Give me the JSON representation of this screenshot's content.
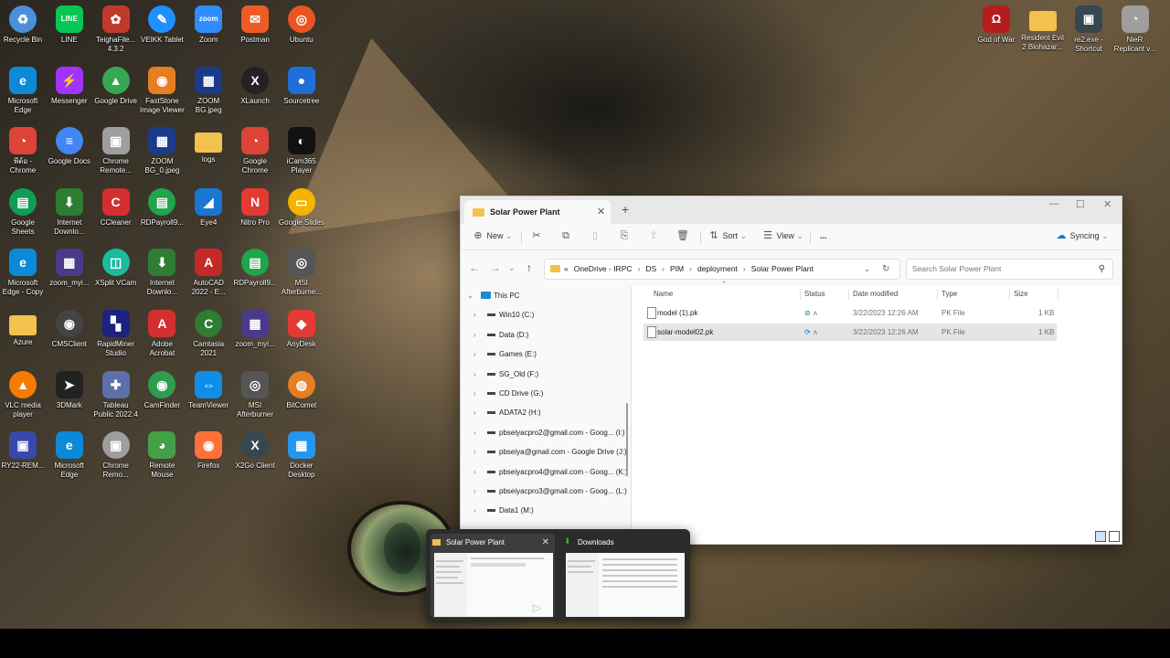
{
  "desktop": {
    "icons_left": [
      {
        "label": "Recycle Bin",
        "icon": "recycle-bin-icon",
        "color": "#4a90d9",
        "glyph": "♻"
      },
      {
        "label": "LINE",
        "icon": "line-icon",
        "color": "#06c755",
        "glyph": "LINE"
      },
      {
        "label": "TeighaFile... 4.3.2",
        "icon": "teigha-icon",
        "color": "#c0392b",
        "glyph": "✿"
      },
      {
        "label": "VEIKK Tablet",
        "icon": "veikk-icon",
        "color": "#1e90ff",
        "glyph": "✎"
      },
      {
        "label": "Zoom",
        "icon": "zoom-icon",
        "color": "#2d8cff",
        "glyph": "zoom"
      },
      {
        "label": "Postman",
        "icon": "postman-icon",
        "color": "#ef5b25",
        "glyph": "✉"
      },
      {
        "label": "Ubuntu",
        "icon": "ubuntu-icon",
        "color": "#e95420",
        "glyph": "◎"
      },
      {
        "label": "Microsoft Edge",
        "icon": "edge-icon",
        "color": "#0c8ad7",
        "glyph": "e"
      },
      {
        "label": "Messenger",
        "icon": "messenger-icon",
        "color": "#a033ff",
        "glyph": "⚡"
      },
      {
        "label": "Google Drive",
        "icon": "google-drive-icon",
        "color": "#34a853",
        "glyph": "▲"
      },
      {
        "label": "FastStone Image Viewer",
        "icon": "faststone-icon",
        "color": "#e67e22",
        "glyph": "◉"
      },
      {
        "label": "ZOOM BG.jpeg",
        "icon": "image-file-icon",
        "color": "#1b3a8a",
        "glyph": "▦"
      },
      {
        "label": "XLaunch",
        "icon": "xlaunch-icon",
        "color": "#222222",
        "glyph": "X"
      },
      {
        "label": "Sourcetree",
        "icon": "sourcetree-icon",
        "color": "#1f6fd6",
        "glyph": "●"
      },
      {
        "label": "พี่ต้อ - Chrome",
        "icon": "chrome-icon",
        "color": "#db4437",
        "glyph": "◔"
      },
      {
        "label": "Google Docs",
        "icon": "google-docs-icon",
        "color": "#4285f4",
        "glyph": "≡"
      },
      {
        "label": "Chrome Remote...",
        "icon": "chrome-remote-icon",
        "color": "#9e9e9e",
        "glyph": "▣"
      },
      {
        "label": "ZOOM BG_0.jpeg",
        "icon": "image-file-icon",
        "color": "#1b3a8a",
        "glyph": "▦"
      },
      {
        "label": "logs",
        "icon": "folder-icon",
        "color": "#f2c14e",
        "glyph": ""
      },
      {
        "label": "Google Chrome",
        "icon": "chrome-icon",
        "color": "#db4437",
        "glyph": "◔"
      },
      {
        "label": "iCam365 Player",
        "icon": "icam-icon",
        "color": "#111111",
        "glyph": "◐"
      },
      {
        "label": "Google Sheets",
        "icon": "google-sheets-icon",
        "color": "#0f9d58",
        "glyph": "▤"
      },
      {
        "label": "Internet Downlo...",
        "icon": "idm-icon",
        "color": "#2e7d32",
        "glyph": "⬇"
      },
      {
        "label": "CCleaner",
        "icon": "ccleaner-icon",
        "color": "#d32f2f",
        "glyph": "C"
      },
      {
        "label": "RDPayroll9...",
        "icon": "rdpayroll-icon",
        "color": "#1fa54a",
        "glyph": "▤"
      },
      {
        "label": "Eye4",
        "icon": "eye4-icon",
        "color": "#1976d2",
        "glyph": "◢"
      },
      {
        "label": "Nitro Pro",
        "icon": "nitro-icon",
        "color": "#e53935",
        "glyph": "N"
      },
      {
        "label": "Google Slides",
        "icon": "google-slides-icon",
        "color": "#f4b400",
        "glyph": "▭"
      },
      {
        "label": "Microsoft Edge - Copy",
        "icon": "edge-icon",
        "color": "#0c8ad7",
        "glyph": "e"
      },
      {
        "label": "zoom_myi...",
        "icon": "image-file-icon",
        "color": "#4a3a8a",
        "glyph": "▦"
      },
      {
        "label": "XSplit VCam",
        "icon": "xsplit-icon",
        "color": "#1abc9c",
        "glyph": "◫"
      },
      {
        "label": "Internet Downlo...",
        "icon": "idm-icon",
        "color": "#2e7d32",
        "glyph": "⬇"
      },
      {
        "label": "AutoCAD 2022 - E...",
        "icon": "autocad-icon",
        "color": "#c62828",
        "glyph": "A"
      },
      {
        "label": "RDPayroll9...",
        "icon": "rdpayroll-icon",
        "color": "#1fa54a",
        "glyph": "▤"
      },
      {
        "label": "MSI Afterburne...",
        "icon": "msi-icon",
        "color": "#555555",
        "glyph": "◎"
      },
      {
        "label": "Azure",
        "icon": "folder-icon",
        "color": "#f2c14e",
        "glyph": ""
      },
      {
        "label": "CMSClient",
        "icon": "cms-icon",
        "color": "#444444",
        "glyph": "◉"
      },
      {
        "label": "RapidMiner Studio",
        "icon": "rapidminer-icon",
        "color": "#1a237e",
        "glyph": "▚"
      },
      {
        "label": "Adobe Acrobat",
        "icon": "acrobat-icon",
        "color": "#d32f2f",
        "glyph": "A"
      },
      {
        "label": "Camtasia 2021",
        "icon": "camtasia-icon",
        "color": "#2e7d32",
        "glyph": "C"
      },
      {
        "label": "zoom_myi...",
        "icon": "image-file-icon",
        "color": "#4a3a8a",
        "glyph": "▦"
      },
      {
        "label": "AnyDesk",
        "icon": "anydesk-icon",
        "color": "#e53935",
        "glyph": "◆"
      },
      {
        "label": "VLC media player",
        "icon": "vlc-icon",
        "color": "#f57c00",
        "glyph": "▲"
      },
      {
        "label": "3DMark",
        "icon": "3dmark-icon",
        "color": "#222222",
        "glyph": "➤"
      },
      {
        "label": "Tableau Public 2022.4",
        "icon": "tableau-icon",
        "color": "#5b6fa8",
        "glyph": "✚"
      },
      {
        "label": "CamFinder",
        "icon": "camfinder-icon",
        "color": "#2e9d4f",
        "glyph": "◉"
      },
      {
        "label": "TeamViewer",
        "icon": "teamviewer-icon",
        "color": "#0e8ee9",
        "glyph": "⇔"
      },
      {
        "label": "MSI Afterburner",
        "icon": "msi-icon",
        "color": "#555555",
        "glyph": "◎"
      },
      {
        "label": "BitComet",
        "icon": "bitcomet-icon",
        "color": "#e67e22",
        "glyph": "◍"
      },
      {
        "label": "RY22-REM...",
        "icon": "remote-desktop-icon",
        "color": "#3949ab",
        "glyph": "▣"
      },
      {
        "label": "Microsoft Edge",
        "icon": "edge-icon",
        "color": "#0c8ad7",
        "glyph": "e"
      },
      {
        "label": "Chrome Remo...",
        "icon": "chrome-remote-icon",
        "color": "#9e9e9e",
        "glyph": "▣"
      },
      {
        "label": "Remote Mouse",
        "icon": "remote-mouse-icon",
        "color": "#43a047",
        "glyph": "◕"
      },
      {
        "label": "Firefox",
        "icon": "firefox-icon",
        "color": "#ff7139",
        "glyph": "◉"
      },
      {
        "label": "X2Go Client",
        "icon": "x2go-icon",
        "color": "#37474f",
        "glyph": "X"
      },
      {
        "label": "Docker Desktop",
        "icon": "docker-icon",
        "color": "#2496ed",
        "glyph": "▦"
      }
    ],
    "icons_right": [
      {
        "label": "God of War",
        "icon": "god-of-war-icon",
        "color": "#b71c1c",
        "glyph": "Ω"
      },
      {
        "label": "Resident Evil 2 Biohazar...",
        "icon": "folder-icon",
        "color": "#f2c14e",
        "glyph": ""
      },
      {
        "label": "re2.exe - Shortcut",
        "icon": "re2-icon",
        "color": "#37474f",
        "glyph": "▣"
      },
      {
        "label": "NieR Replicant v...",
        "icon": "nier-icon",
        "color": "#9e9e9e",
        "glyph": "◔"
      }
    ]
  },
  "explorer": {
    "tab_title": "Solar Power Plant",
    "toolbar": {
      "new": "New",
      "sort": "Sort",
      "view": "View",
      "more": "...",
      "syncing": "Syncing"
    },
    "address": {
      "prefix": "«",
      "crumbs": [
        "OneDrive - IRPC",
        "DS",
        "PIM",
        "deployment",
        "Solar Power Plant"
      ]
    },
    "search_placeholder": "Search Solar Power Plant",
    "sidebar": [
      {
        "label": "This PC",
        "level": 0
      },
      {
        "label": "Win10 (C:)",
        "level": 1
      },
      {
        "label": "Data (D:)",
        "level": 1
      },
      {
        "label": "Games (E:)",
        "level": 1
      },
      {
        "label": "SG_Old (F:)",
        "level": 1
      },
      {
        "label": "CD Drive (G:)",
        "level": 1
      },
      {
        "label": "ADATA2 (H:)",
        "level": 1
      },
      {
        "label": "pbseiyacpro2@gmail.com - Goog... (I:)",
        "level": 1
      },
      {
        "label": "pbseiya@gmail.com - Google Drive (J:)",
        "level": 1
      },
      {
        "label": "pbseiyacpro4@gmail.com - Goog... (K:)",
        "level": 1
      },
      {
        "label": "pbseiyacpro3@gmail.com - Goog... (L:)",
        "level": 1
      },
      {
        "label": "Data1 (M:)",
        "level": 1
      }
    ],
    "columns": {
      "name": "Name",
      "status": "Status",
      "date": "Date modified",
      "type": "Type",
      "size": "Size"
    },
    "files": [
      {
        "name": "model (1).pk",
        "status": "synced",
        "date": "3/22/2023 12:26 AM",
        "type": "PK File",
        "size": "1 KB",
        "selected": false
      },
      {
        "name": "solar-model02.pk",
        "status": "syncing",
        "date": "3/22/2023 12:26 AM",
        "type": "PK File",
        "size": "1 KB",
        "selected": true
      }
    ]
  },
  "taskbar_preview": {
    "items": [
      {
        "title": "Solar Power Plant",
        "icon": "folder-icon",
        "active": true
      },
      {
        "title": "Downloads",
        "icon": "download-icon",
        "active": false
      }
    ]
  }
}
